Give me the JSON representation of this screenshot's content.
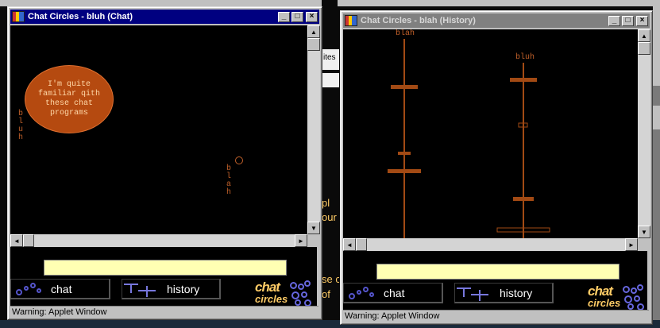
{
  "background": {
    "fragments_left": [
      "pl",
      "our",
      "se c",
      "of"
    ],
    "fragments_light": [
      "ites"
    ]
  },
  "chat_window": {
    "title": "Chat Circles - bluh (Chat)",
    "bubble_text": "I'm quite familiar qith these chat programs",
    "self_name": "bluh",
    "other_name": "blah",
    "input_value": "",
    "chat_button_label": "chat",
    "history_button_label": "history",
    "logo_line1": "chat",
    "logo_line2": "circles",
    "status": "Warning: Applet Window"
  },
  "history_window": {
    "title": "Chat Circles - blah (History)",
    "lane1_name": "blah",
    "lane2_name": "bluh",
    "input_value": "",
    "chat_button_label": "chat",
    "history_button_label": "history",
    "logo_line1": "chat",
    "logo_line2": "circles",
    "status": "Warning: Applet Window"
  },
  "colors": {
    "accent": "#b54a10",
    "text_orange": "#c0602a",
    "input_bg": "#ffffb3",
    "titlebar_active": "#000080",
    "titlebar_inactive": "#808080",
    "icon_blue": "#5555cc"
  },
  "icons": {
    "minimize": "minimize-icon",
    "maximize": "maximize-icon",
    "close": "close-icon",
    "scroll_up": "arrow-up-icon",
    "scroll_down": "arrow-down-icon",
    "scroll_left": "arrow-left-icon",
    "scroll_right": "arrow-right-icon"
  }
}
